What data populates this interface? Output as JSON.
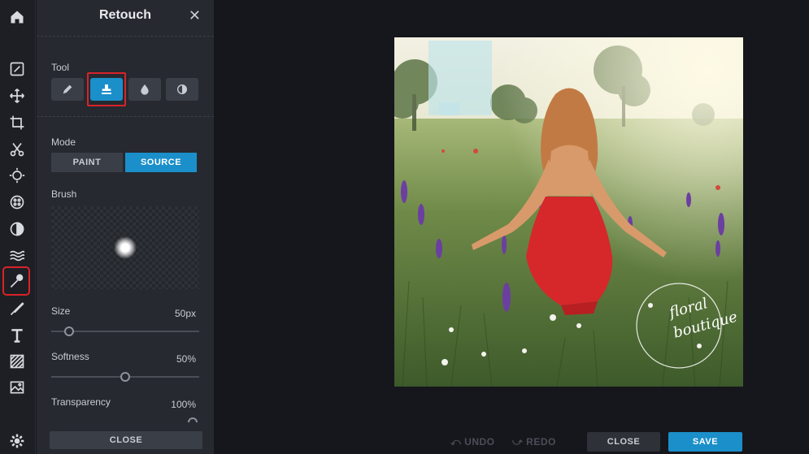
{
  "panel": {
    "title": "Retouch",
    "close_x": "✕",
    "tool_label": "Tool",
    "mode_label": "Mode",
    "modes": [
      "PAINT",
      "SOURCE"
    ],
    "selected_mode": "SOURCE",
    "brush_label": "Brush",
    "size_label": "Size",
    "size_value": "50px",
    "softness_label": "Softness",
    "softness_value": "50%",
    "transparency_label": "Transparency",
    "transparency_value": "100%",
    "close_label": "CLOSE",
    "tools": [
      "pencil-icon",
      "clone-stamp-icon",
      "drop-icon",
      "contrast-icon"
    ],
    "selected_tool": "clone-stamp-icon",
    "size_slider": 0.12,
    "softness_slider": 0.5
  },
  "rail": {
    "icons": [
      "home-icon",
      "edit-icon",
      "move-icon",
      "crop-icon",
      "cut-icon",
      "adjust-icon",
      "effects-icon",
      "filter-icon",
      "wave-icon",
      "retouch-icon",
      "brush-icon",
      "text-icon",
      "pattern-icon",
      "image-icon",
      "settings-icon"
    ],
    "active": "retouch-icon"
  },
  "photo": {
    "watermark_line1": "floral",
    "watermark_line2": "boutique"
  },
  "footer": {
    "undo_label": "UNDO",
    "redo_label": "REDO",
    "close_label": "CLOSE",
    "save_label": "SAVE"
  },
  "colors": {
    "accent": "#1b8fc9",
    "highlight": "#d8232a",
    "panel_bg": "#26292f",
    "app_bg": "#16171c"
  }
}
